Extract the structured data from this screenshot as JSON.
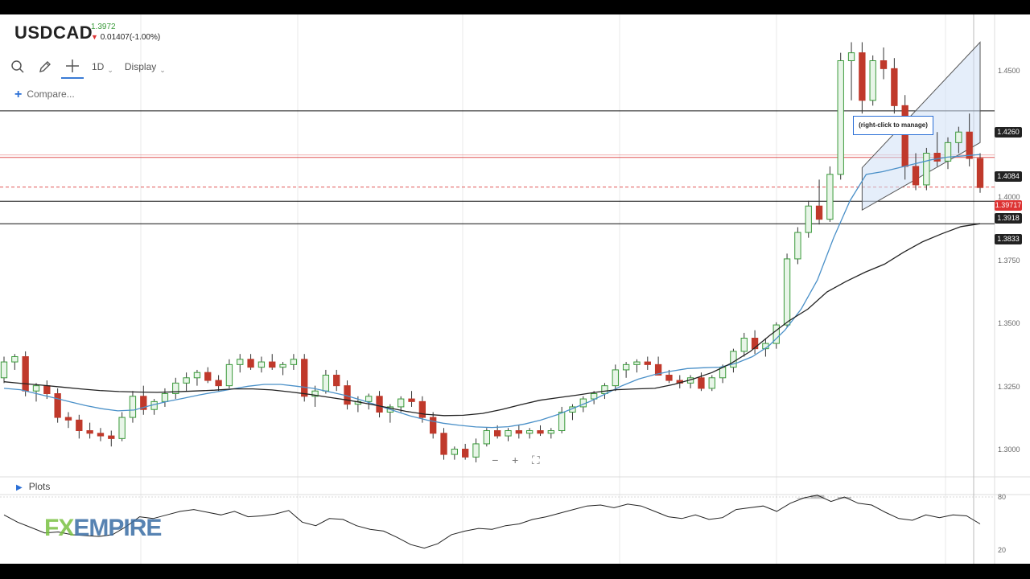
{
  "header": {
    "symbol": "USDCAD",
    "last_price": "1.3972",
    "change": "0.01407(-1.00%)"
  },
  "toolbar": {
    "interval": "1D",
    "display": "Display"
  },
  "compare": {
    "label": "Compare..."
  },
  "plots": {
    "label": "Plots"
  },
  "annotation": {
    "text": "(right-click to manage)"
  },
  "logo": {
    "part1": "FX",
    "part2": "EMPIRE"
  },
  "price_tags": {
    "t4260": "1.4260",
    "t4084": "1.4084",
    "t39717": "1.39717",
    "t3918": "1.3918",
    "t3833": "1.3833"
  },
  "axis": {
    "a14500": "1.4500",
    "a14000": "1.4000",
    "a13750": "1.3750",
    "a13500": "1.3500",
    "a13250": "1.3250",
    "a13000": "1.3000",
    "r80": "80",
    "r20": "20"
  },
  "colors": {
    "up": "#3a9a3a",
    "down": "#c0392b",
    "ma_fast": "#4a90c8",
    "ma_slow": "#222222",
    "horizontal_line": "#111111",
    "red_line": "#e05555"
  },
  "chart_data": {
    "type": "candlestick",
    "symbol": "USDCAD",
    "timeframe": "1D",
    "ylim": [
      1.2875,
      1.4625
    ],
    "yticks": [
      1.3,
      1.325,
      1.35,
      1.375,
      1.4,
      1.45
    ],
    "horizontal_levels": [
      1.426,
      1.4084,
      1.3918,
      1.3833
    ],
    "current_price": 1.39717,
    "candles": [
      [
        1.325,
        1.333,
        1.323,
        1.331
      ],
      [
        1.331,
        1.334,
        1.328,
        1.333
      ],
      [
        1.333,
        1.335,
        1.318,
        1.32
      ],
      [
        1.32,
        1.323,
        1.316,
        1.322
      ],
      [
        1.322,
        1.324,
        1.317,
        1.319
      ],
      [
        1.319,
        1.321,
        1.308,
        1.31
      ],
      [
        1.31,
        1.312,
        1.306,
        1.309
      ],
      [
        1.309,
        1.311,
        1.302,
        1.305
      ],
      [
        1.305,
        1.308,
        1.302,
        1.304
      ],
      [
        1.304,
        1.306,
        1.301,
        1.303
      ],
      [
        1.303,
        1.305,
        1.299,
        1.302
      ],
      [
        1.302,
        1.312,
        1.301,
        1.31
      ],
      [
        1.31,
        1.32,
        1.308,
        1.318
      ],
      [
        1.318,
        1.322,
        1.311,
        1.313
      ],
      [
        1.313,
        1.317,
        1.311,
        1.316
      ],
      [
        1.316,
        1.321,
        1.314,
        1.319
      ],
      [
        1.319,
        1.325,
        1.317,
        1.323
      ],
      [
        1.323,
        1.327,
        1.32,
        1.325
      ],
      [
        1.325,
        1.328,
        1.322,
        1.327
      ],
      [
        1.327,
        1.329,
        1.323,
        1.324
      ],
      [
        1.324,
        1.326,
        1.32,
        1.322
      ],
      [
        1.322,
        1.332,
        1.321,
        1.33
      ],
      [
        1.33,
        1.334,
        1.327,
        1.332
      ],
      [
        1.332,
        1.334,
        1.328,
        1.329
      ],
      [
        1.329,
        1.333,
        1.327,
        1.331
      ],
      [
        1.331,
        1.334,
        1.328,
        1.329
      ],
      [
        1.329,
        1.331,
        1.326,
        1.33
      ],
      [
        1.33,
        1.334,
        1.328,
        1.332
      ],
      [
        1.332,
        1.334,
        1.316,
        1.318
      ],
      [
        1.318,
        1.322,
        1.314,
        1.32
      ],
      [
        1.32,
        1.328,
        1.319,
        1.326
      ],
      [
        1.326,
        1.328,
        1.32,
        1.322
      ],
      [
        1.322,
        1.324,
        1.313,
        1.315
      ],
      [
        1.315,
        1.318,
        1.312,
        1.316
      ],
      [
        1.316,
        1.319,
        1.313,
        1.318
      ],
      [
        1.318,
        1.32,
        1.31,
        1.312
      ],
      [
        1.312,
        1.315,
        1.308,
        1.314
      ],
      [
        1.314,
        1.318,
        1.312,
        1.317
      ],
      [
        1.317,
        1.32,
        1.314,
        1.316
      ],
      [
        1.316,
        1.318,
        1.308,
        1.31
      ],
      [
        1.31,
        1.312,
        1.302,
        1.304
      ],
      [
        1.304,
        1.306,
        1.294,
        1.296
      ],
      [
        1.296,
        1.299,
        1.294,
        1.298
      ],
      [
        1.298,
        1.3,
        1.294,
        1.295
      ],
      [
        1.295,
        1.302,
        1.293,
        1.3
      ],
      [
        1.3,
        1.306,
        1.299,
        1.305
      ],
      [
        1.305,
        1.307,
        1.302,
        1.303
      ],
      [
        1.303,
        1.306,
        1.301,
        1.305
      ],
      [
        1.305,
        1.307,
        1.302,
        1.304
      ],
      [
        1.304,
        1.306,
        1.302,
        1.305
      ],
      [
        1.305,
        1.307,
        1.303,
        1.304
      ],
      [
        1.304,
        1.306,
        1.302,
        1.305
      ],
      [
        1.305,
        1.314,
        1.304,
        1.312
      ],
      [
        1.312,
        1.315,
        1.309,
        1.314
      ],
      [
        1.314,
        1.318,
        1.312,
        1.317
      ],
      [
        1.317,
        1.32,
        1.315,
        1.319
      ],
      [
        1.319,
        1.323,
        1.317,
        1.322
      ],
      [
        1.322,
        1.33,
        1.32,
        1.328
      ],
      [
        1.328,
        1.331,
        1.325,
        1.33
      ],
      [
        1.33,
        1.332,
        1.327,
        1.331
      ],
      [
        1.331,
        1.333,
        1.328,
        1.33
      ],
      [
        1.33,
        1.333,
        1.327,
        1.326
      ],
      [
        1.326,
        1.328,
        1.323,
        1.324
      ],
      [
        1.324,
        1.326,
        1.321,
        1.323
      ],
      [
        1.323,
        1.326,
        1.321,
        1.325
      ],
      [
        1.325,
        1.327,
        1.32,
        1.321
      ],
      [
        1.321,
        1.326,
        1.32,
        1.325
      ],
      [
        1.325,
        1.33,
        1.323,
        1.329
      ],
      [
        1.329,
        1.336,
        1.327,
        1.335
      ],
      [
        1.335,
        1.342,
        1.333,
        1.34
      ],
      [
        1.34,
        1.343,
        1.334,
        1.336
      ],
      [
        1.336,
        1.34,
        1.333,
        1.338
      ],
      [
        1.338,
        1.346,
        1.336,
        1.345
      ],
      [
        1.345,
        1.372,
        1.344,
        1.37
      ],
      [
        1.37,
        1.382,
        1.368,
        1.38
      ],
      [
        1.38,
        1.392,
        1.378,
        1.39
      ],
      [
        1.39,
        1.4,
        1.383,
        1.385
      ],
      [
        1.385,
        1.405,
        1.384,
        1.402
      ],
      [
        1.402,
        1.448,
        1.4,
        1.445
      ],
      [
        1.445,
        1.452,
        1.43,
        1.448
      ],
      [
        1.448,
        1.452,
        1.425,
        1.43
      ],
      [
        1.43,
        1.447,
        1.428,
        1.445
      ],
      [
        1.445,
        1.45,
        1.438,
        1.442
      ],
      [
        1.442,
        1.446,
        1.425,
        1.428
      ],
      [
        1.428,
        1.432,
        1.4,
        1.405
      ],
      [
        1.405,
        1.41,
        1.396,
        1.398
      ],
      [
        1.398,
        1.412,
        1.396,
        1.41
      ],
      [
        1.41,
        1.418,
        1.405,
        1.407
      ],
      [
        1.407,
        1.416,
        1.404,
        1.414
      ],
      [
        1.414,
        1.42,
        1.41,
        1.418
      ],
      [
        1.418,
        1.425,
        1.405,
        1.408
      ],
      [
        1.408,
        1.41,
        1.395,
        1.397
      ]
    ],
    "ma_fast": [
      1.321,
      1.3205,
      1.319,
      1.3175,
      1.316,
      1.3145,
      1.3133,
      1.3125,
      1.3128,
      1.3145,
      1.316,
      1.3172,
      1.3185,
      1.3196,
      1.3207,
      1.3218,
      1.3225,
      1.3225,
      1.3218,
      1.321,
      1.3197,
      1.3183,
      1.3165,
      1.3145,
      1.3125,
      1.3105,
      1.309,
      1.3078,
      1.307,
      1.3064,
      1.3062,
      1.3065,
      1.3075,
      1.309,
      1.311,
      1.3135,
      1.316,
      1.319,
      1.322,
      1.3245,
      1.3262,
      1.3275,
      1.3285,
      1.3288,
      1.329,
      1.3305,
      1.333,
      1.337,
      1.343,
      1.351,
      1.362,
      1.378,
      1.392,
      1.402,
      1.403,
      1.4045,
      1.406,
      1.4075,
      1.4085,
      1.409,
      1.4095
    ],
    "ma_slow": [
      1.3235,
      1.3228,
      1.3222,
      1.3215,
      1.3208,
      1.3202,
      1.3198,
      1.3196,
      1.3195,
      1.3197,
      1.32,
      1.3203,
      1.3208,
      1.3208,
      1.3204,
      1.3196,
      1.3187,
      1.3176,
      1.3165,
      1.3152,
      1.3138,
      1.3123,
      1.3112,
      1.3107,
      1.3108,
      1.3115,
      1.313,
      1.3148,
      1.3165,
      1.3175,
      1.3185,
      1.3196,
      1.3205,
      1.3208,
      1.321,
      1.3225,
      1.3245,
      1.327,
      1.3305,
      1.335,
      1.341,
      1.3465,
      1.351,
      1.3575,
      1.3615,
      1.365,
      1.368,
      1.3725,
      1.3765,
      1.3795,
      1.3822,
      1.3833
    ],
    "rsi_range": [
      20,
      80
    ],
    "rsi": [
      60,
      52,
      46,
      40,
      41,
      38,
      37,
      36,
      38,
      47,
      58,
      56,
      60,
      64,
      66,
      63,
      60,
      64,
      58,
      59,
      61,
      65,
      52,
      48,
      56,
      55,
      48,
      44,
      42,
      35,
      27,
      23,
      28,
      38,
      42,
      45,
      44,
      48,
      50,
      55,
      58,
      62,
      66,
      70,
      71,
      68,
      72,
      70,
      64,
      58,
      56,
      60,
      55,
      57,
      66,
      68,
      70,
      64,
      73,
      79,
      82,
      75,
      80,
      73,
      71,
      63,
      56,
      54,
      60,
      57,
      60,
      59,
      50
    ]
  }
}
